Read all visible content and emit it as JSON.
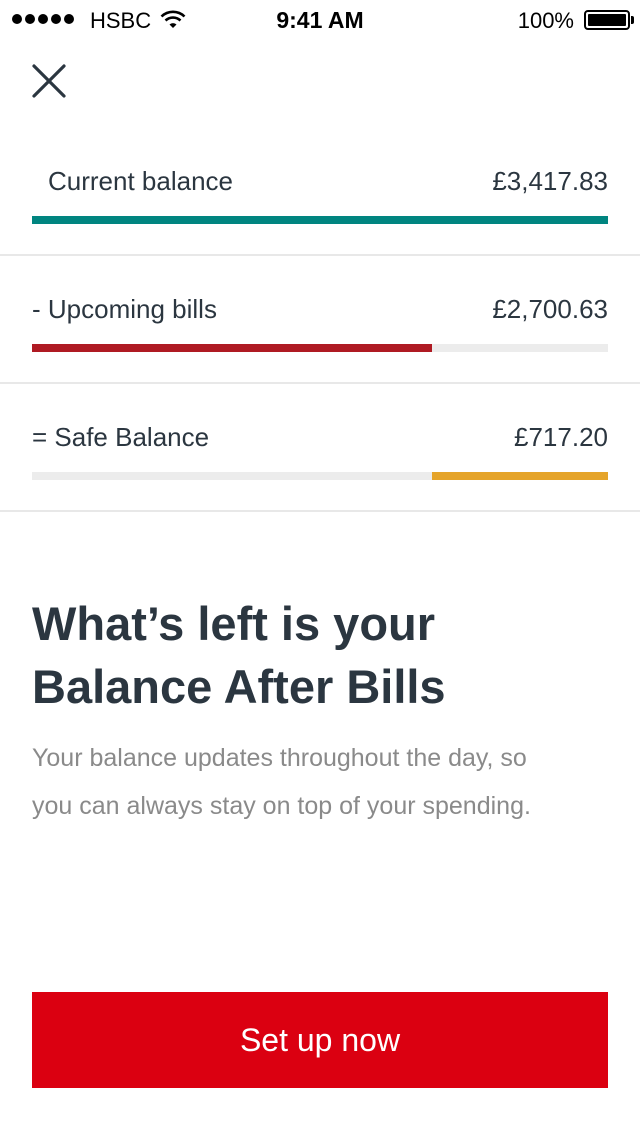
{
  "status_bar": {
    "carrier": "HSBC",
    "time": "9:41 AM",
    "battery": "100%",
    "icons": [
      "signal-dots-icon",
      "wifi-icon",
      "battery-icon"
    ]
  },
  "close_icon": "close-icon",
  "balances": {
    "current": {
      "label": "Current balance",
      "amount": "£3,417.83",
      "color": "#008580",
      "fill_fraction": 1.0
    },
    "upcoming": {
      "label": "- Upcoming bills",
      "amount": "£2,700.63",
      "color": "#af1a23",
      "fill_fraction": 0.694
    },
    "safe": {
      "label": "= Safe Balance",
      "amount": "£717.20",
      "color": "#e5a42a",
      "fill_fraction": 0.306
    }
  },
  "info": {
    "title": "What’s left is your Balance After Bills",
    "body": "Your balance updates throughout the day, so you can always stay on top of your spending."
  },
  "cta": {
    "label": "Set up now",
    "color": "#db0011"
  }
}
